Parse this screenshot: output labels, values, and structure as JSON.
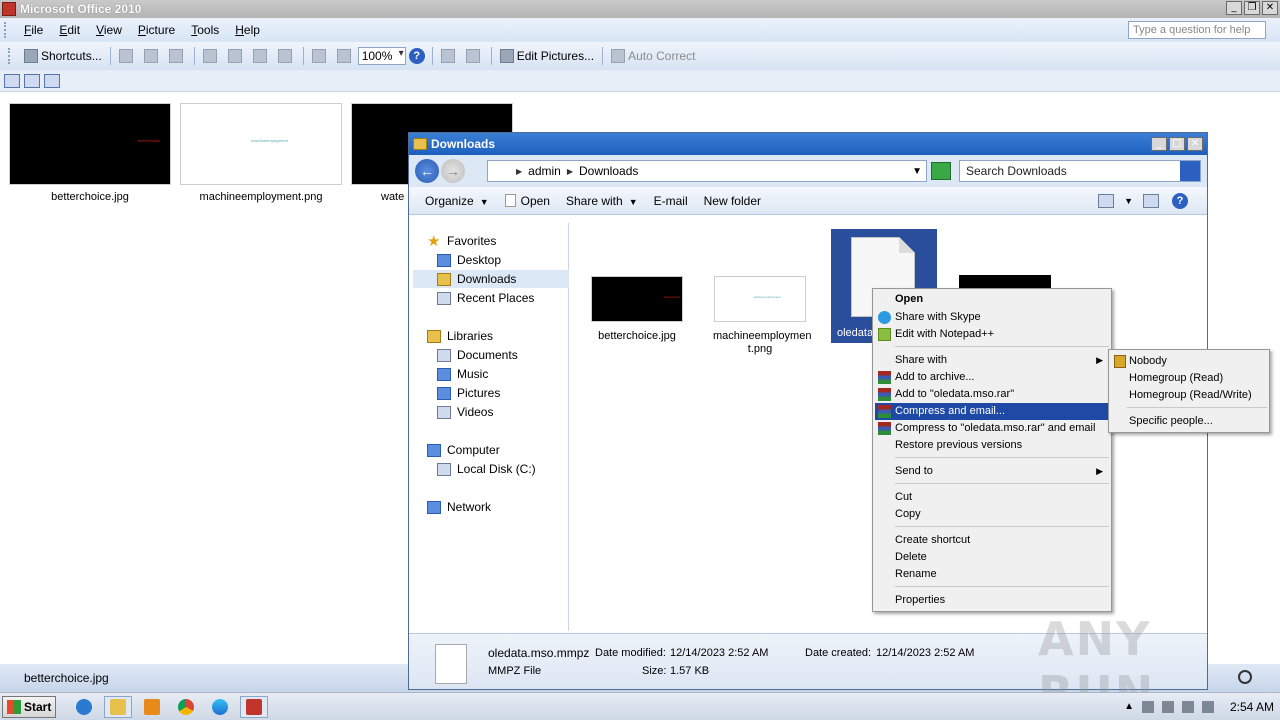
{
  "app": {
    "title": "Microsoft Office 2010",
    "menu": [
      "File",
      "Edit",
      "View",
      "Picture",
      "Tools",
      "Help"
    ],
    "help_placeholder": "Type a question for help",
    "toolbar": {
      "shortcuts": "Shortcuts...",
      "zoom": "100%",
      "edit_pictures": "Edit Pictures...",
      "auto_correct": "Auto Correct"
    },
    "thumbnails": [
      {
        "name": "betterchoice.jpg",
        "inner_text": "betterchoice"
      },
      {
        "name": "machineemployment.png",
        "inner_text": "machineemployment"
      },
      {
        "name": "wate"
      }
    ],
    "status": "betterchoice.jpg"
  },
  "explorer": {
    "title": "Downloads",
    "breadcrumb": [
      "admin",
      "Downloads"
    ],
    "search_placeholder": "Search Downloads",
    "commands": [
      "Organize",
      "Open",
      "Share with",
      "E-mail",
      "New folder"
    ],
    "nav": {
      "favorites": "Favorites",
      "desktop": "Desktop",
      "downloads": "Downloads",
      "recent": "Recent Places",
      "libraries": "Libraries",
      "documents": "Documents",
      "music": "Music",
      "pictures": "Pictures",
      "videos": "Videos",
      "computer": "Computer",
      "local_disk": "Local Disk (C:)",
      "network": "Network"
    },
    "files": {
      "f1": "betterchoice.jpg",
      "f2_line1": "machineemploymen",
      "f2_line2": "t.png",
      "f3_partial": "oledata"
    },
    "details": {
      "name": "oledata.mso.mmpz",
      "type": "MMPZ File",
      "modified_label": "Date modified:",
      "modified": "12/14/2023 2:52 AM",
      "created_label": "Date created:",
      "created": "12/14/2023 2:52 AM",
      "size_label": "Size:",
      "size": "1.57 KB"
    }
  },
  "context_menu": {
    "open": "Open",
    "skype": "Share with Skype",
    "npp": "Edit with Notepad++",
    "share_with": "Share with",
    "add_archive": "Add to archive...",
    "add_rar": "Add to \"oledata.mso.rar\"",
    "compress_email": "Compress and email...",
    "compress_rar_email": "Compress to \"oledata.mso.rar\" and email",
    "restore": "Restore previous versions",
    "send_to": "Send to",
    "cut": "Cut",
    "copy": "Copy",
    "create_shortcut": "Create shortcut",
    "delete": "Delete",
    "rename": "Rename",
    "properties": "Properties"
  },
  "share_submenu": {
    "nobody": "Nobody",
    "homegroup_read": "Homegroup (Read)",
    "homegroup_rw": "Homegroup (Read/Write)",
    "specific": "Specific people..."
  },
  "taskbar": {
    "start": "Start",
    "clock": "2:54 AM"
  },
  "watermark": "ANY RUN"
}
